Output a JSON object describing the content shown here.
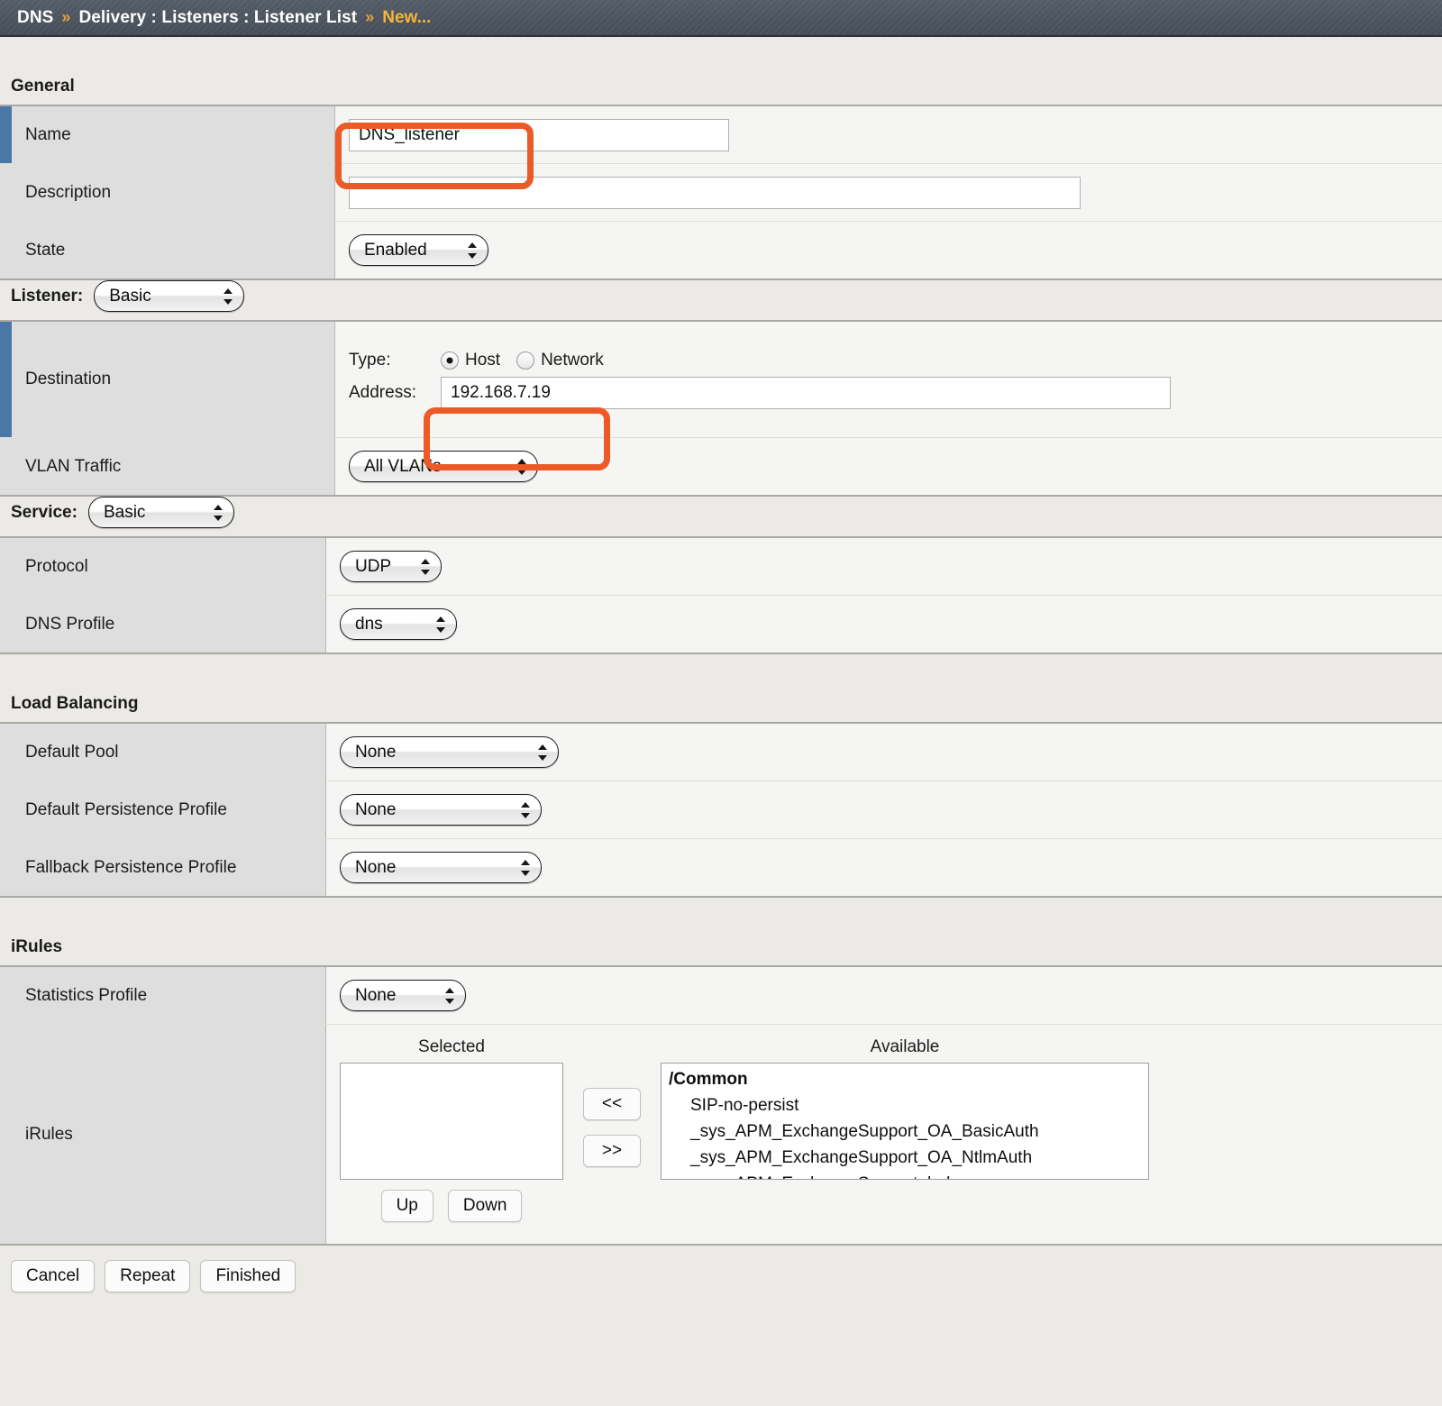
{
  "breadcrumb": {
    "root": "DNS",
    "sep": "»",
    "path": "Delivery : Listeners : Listener List",
    "current": "New..."
  },
  "sections": {
    "general": {
      "title": "General",
      "name_label": "Name",
      "name_value": "DNS_listener",
      "description_label": "Description",
      "description_value": "",
      "state_label": "State",
      "state_value": "Enabled"
    },
    "listener": {
      "label": "Listener:",
      "mode": "Basic",
      "destination_label": "Destination",
      "type_label": "Type:",
      "type_host": "Host",
      "type_network": "Network",
      "type_selected": "Host",
      "address_label": "Address:",
      "address_value": "192.168.7.19",
      "vlan_label": "VLAN Traffic",
      "vlan_value": "All VLANs"
    },
    "service": {
      "label": "Service:",
      "mode": "Basic",
      "protocol_label": "Protocol",
      "protocol_value": "UDP",
      "dns_profile_label": "DNS Profile",
      "dns_profile_value": "dns"
    },
    "load_balancing": {
      "title": "Load Balancing",
      "default_pool_label": "Default Pool",
      "default_pool_value": "None",
      "default_persistence_label": "Default Persistence Profile",
      "default_persistence_value": "None",
      "fallback_persistence_label": "Fallback Persistence Profile",
      "fallback_persistence_value": "None"
    },
    "irules": {
      "title": "iRules",
      "statistics_label": "Statistics Profile",
      "statistics_value": "None",
      "row_label": "iRules",
      "selected_header": "Selected",
      "available_header": "Available",
      "selected_items": [],
      "available_group": "/Common",
      "available_items": [
        "SIP-no-persist",
        "_sys_APM_ExchangeSupport_OA_BasicAuth",
        "_sys_APM_ExchangeSupport_OA_NtlmAuth",
        "_sys_APM_ExchangeSupport_helper"
      ],
      "move_left": "<<",
      "move_right": ">>",
      "up": "Up",
      "down": "Down"
    }
  },
  "footer": {
    "cancel": "Cancel",
    "repeat": "Repeat",
    "finished": "Finished"
  },
  "colors": {
    "header_bg": "#4a525c",
    "breadcrumb_accent": "#f3b63c",
    "annotation": "#ec5a27",
    "required_marker": "#4a76a8",
    "label_cell": "#dedede",
    "value_cell": "#f5f5f3",
    "page_bg": "#eceae6"
  }
}
